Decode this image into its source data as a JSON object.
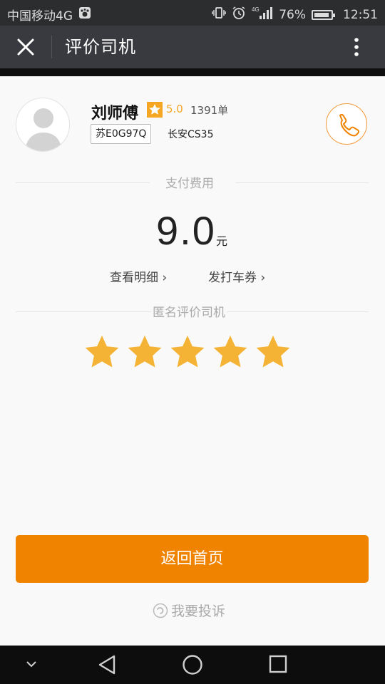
{
  "status_bar": {
    "carrier": "中国移动4G",
    "network_small": "4G",
    "battery": "76%",
    "time": "12:51"
  },
  "header": {
    "title": "评价司机",
    "close_icon": "close-icon",
    "more_icon": "more-vertical-icon"
  },
  "driver": {
    "name": "刘师傅",
    "rating": "5.0",
    "orders": "1391单",
    "plate": "苏E0G97Q",
    "car_model": "长安CS35"
  },
  "payment": {
    "section_title": "支付费用",
    "amount": "9.0",
    "unit": "元",
    "detail_link": "查看明细 ›",
    "coupon_link": "发打车券 ›"
  },
  "review": {
    "section_title": "匿名评价司机",
    "stars_selected": 5,
    "stars_total": 5
  },
  "actions": {
    "home_button": "返回首页",
    "complain": "我要投诉"
  },
  "colors": {
    "accent": "#f08300",
    "star": "#f5b335",
    "rating_text": "#f5a623",
    "navbar": "#393a3f"
  }
}
